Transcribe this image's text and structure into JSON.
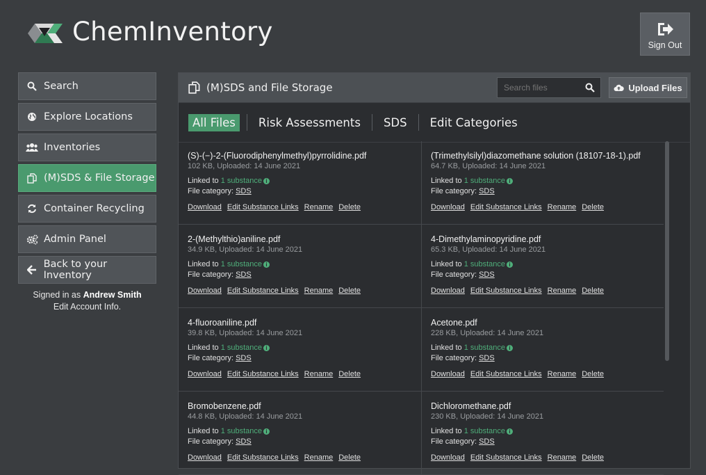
{
  "app": {
    "title": "ChemInventory",
    "sign_out": "Sign Out"
  },
  "sidebar": {
    "items": [
      {
        "label": "Search",
        "icon": "search-icon"
      },
      {
        "label": "Explore Locations",
        "icon": "globe-icon"
      },
      {
        "label": "Inventories",
        "icon": "users-icon"
      },
      {
        "label": "(M)SDS & File Storage",
        "icon": "copy-files-icon",
        "active": true
      },
      {
        "label": "Container Recycling",
        "icon": "recycle-icon"
      },
      {
        "label": "Admin Panel",
        "icon": "gears-icon"
      },
      {
        "label": "Back to your Inventory",
        "icon": "arrow-left-icon"
      }
    ],
    "signed_in_prefix": "Signed in as",
    "user_name": "Andrew Smith",
    "edit_account": "Edit Account Info."
  },
  "panel": {
    "title": "(M)SDS and File Storage",
    "search_placeholder": "Search files",
    "upload_label": "Upload Files",
    "tabs": [
      "All Files",
      "Risk Assessments",
      "SDS",
      "Edit Categories"
    ]
  },
  "labels": {
    "linked_to": "Linked to",
    "substance": "1 substance",
    "file_category": "File category:",
    "download": "Download",
    "edit_links": "Edit Substance Links",
    "rename": "Rename",
    "delete": "Delete"
  },
  "files": [
    {
      "name": "(S)-(−)-2-(Fluorodiphenylmethyl)pyrrolidine.pdf",
      "meta": "102 KB, Uploaded: 14 June 2021",
      "category": "SDS"
    },
    {
      "name": "(Trimethylsilyl)diazomethane solution (18107-18-1).pdf",
      "meta": "64.7 KB, Uploaded: 14 June 2021",
      "category": "SDS"
    },
    {
      "name": "2-(Methylthio)aniline.pdf",
      "meta": "34.9 KB, Uploaded: 14 June 2021",
      "category": "SDS"
    },
    {
      "name": "4-Dimethylaminopyridine.pdf",
      "meta": "65.3 KB, Uploaded: 14 June 2021",
      "category": "SDS"
    },
    {
      "name": "4-fluoroaniline.pdf",
      "meta": "39.8 KB, Uploaded: 14 June 2021",
      "category": "SDS"
    },
    {
      "name": "Acetone.pdf",
      "meta": "228 KB, Uploaded: 14 June 2021",
      "category": "SDS"
    },
    {
      "name": "Bromobenzene.pdf",
      "meta": "44.8 KB, Uploaded: 14 June 2021",
      "category": "SDS"
    },
    {
      "name": "Dichloromethane.pdf",
      "meta": "230 KB, Uploaded: 14 June 2021",
      "category": "SDS"
    }
  ],
  "colors": {
    "accent": "#4a9a6e",
    "link_green": "#4fae7a",
    "background": "#3a3d40"
  }
}
